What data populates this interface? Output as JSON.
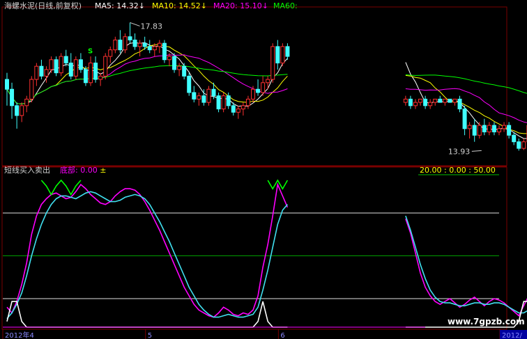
{
  "chart_data": [
    {
      "type": "candlestick",
      "title": "海螺水泥(日线,前复权)",
      "indicators": [
        {
          "name": "MA5",
          "value": "14.32",
          "arrow": "↓",
          "color": "#ffffff"
        },
        {
          "name": "MA10",
          "value": "14.52",
          "arrow": "↓",
          "color": "#ffff00"
        },
        {
          "name": "MA20",
          "value": "15.10",
          "arrow": "↓",
          "color": "#ff00ff"
        },
        {
          "name": "MA60",
          "value": "",
          "arrow": "",
          "color": "#00ff00"
        }
      ],
      "annotations": [
        {
          "text": "17.83",
          "index": 25,
          "price": 17.83,
          "side": "right"
        },
        {
          "text": "13.93",
          "index": 97,
          "price": 13.93,
          "side": "left"
        }
      ],
      "signals": [
        {
          "text": "S",
          "index": 17,
          "price": 16.6,
          "color": "#00ff00"
        }
      ],
      "ylim": [
        13.6,
        18.2
      ],
      "candles": [
        {
          "o": 16.1,
          "h": 16.3,
          "l": 15.3,
          "c": 15.8
        },
        {
          "o": 15.8,
          "h": 16.0,
          "l": 14.9,
          "c": 15.3
        },
        {
          "o": 15.3,
          "h": 15.4,
          "l": 14.6,
          "c": 15.0
        },
        {
          "o": 15.0,
          "h": 15.4,
          "l": 14.8,
          "c": 15.3
        },
        {
          "o": 15.3,
          "h": 15.6,
          "l": 15.1,
          "c": 15.5
        },
        {
          "o": 15.5,
          "h": 16.2,
          "l": 15.4,
          "c": 16.1
        },
        {
          "o": 16.1,
          "h": 16.6,
          "l": 15.9,
          "c": 16.5
        },
        {
          "o": 16.5,
          "h": 16.7,
          "l": 16.1,
          "c": 16.2
        },
        {
          "o": 16.2,
          "h": 16.5,
          "l": 16.0,
          "c": 16.4
        },
        {
          "o": 16.4,
          "h": 16.8,
          "l": 16.3,
          "c": 16.7
        },
        {
          "o": 16.7,
          "h": 16.8,
          "l": 16.2,
          "c": 16.3
        },
        {
          "o": 16.3,
          "h": 16.9,
          "l": 16.2,
          "c": 16.8
        },
        {
          "o": 16.8,
          "h": 17.0,
          "l": 16.5,
          "c": 16.6
        },
        {
          "o": 16.6,
          "h": 16.9,
          "l": 16.1,
          "c": 16.2
        },
        {
          "o": 16.2,
          "h": 16.8,
          "l": 16.1,
          "c": 16.7
        },
        {
          "o": 16.7,
          "h": 16.9,
          "l": 16.3,
          "c": 16.4
        },
        {
          "o": 16.4,
          "h": 16.5,
          "l": 15.9,
          "c": 16.0
        },
        {
          "o": 16.0,
          "h": 16.8,
          "l": 15.9,
          "c": 16.6
        },
        {
          "o": 16.6,
          "h": 16.8,
          "l": 16.0,
          "c": 16.1
        },
        {
          "o": 16.1,
          "h": 16.3,
          "l": 15.9,
          "c": 16.2
        },
        {
          "o": 16.2,
          "h": 16.9,
          "l": 16.1,
          "c": 16.8
        },
        {
          "o": 16.8,
          "h": 17.1,
          "l": 16.6,
          "c": 17.0
        },
        {
          "o": 17.0,
          "h": 17.4,
          "l": 16.9,
          "c": 17.3
        },
        {
          "o": 17.3,
          "h": 17.6,
          "l": 16.9,
          "c": 17.0
        },
        {
          "o": 17.0,
          "h": 17.5,
          "l": 16.9,
          "c": 17.4
        },
        {
          "o": 17.4,
          "h": 17.83,
          "l": 17.2,
          "c": 17.3
        },
        {
          "o": 17.3,
          "h": 17.5,
          "l": 17.0,
          "c": 17.1
        },
        {
          "o": 17.1,
          "h": 17.3,
          "l": 16.8,
          "c": 17.2
        },
        {
          "o": 17.2,
          "h": 17.4,
          "l": 17.0,
          "c": 17.1
        },
        {
          "o": 17.1,
          "h": 17.3,
          "l": 16.9,
          "c": 17.0
        },
        {
          "o": 17.0,
          "h": 17.2,
          "l": 16.8,
          "c": 17.1
        },
        {
          "o": 17.1,
          "h": 17.3,
          "l": 16.9,
          "c": 17.2
        },
        {
          "o": 17.2,
          "h": 17.3,
          "l": 16.6,
          "c": 16.7
        },
        {
          "o": 16.7,
          "h": 16.9,
          "l": 16.5,
          "c": 16.8
        },
        {
          "o": 16.8,
          "h": 16.9,
          "l": 16.3,
          "c": 16.4
        },
        {
          "o": 16.4,
          "h": 16.6,
          "l": 16.2,
          "c": 16.5
        },
        {
          "o": 16.5,
          "h": 16.6,
          "l": 16.1,
          "c": 16.2
        },
        {
          "o": 16.2,
          "h": 16.3,
          "l": 15.6,
          "c": 15.7
        },
        {
          "o": 15.7,
          "h": 15.9,
          "l": 15.4,
          "c": 15.5
        },
        {
          "o": 15.5,
          "h": 15.7,
          "l": 15.3,
          "c": 15.6
        },
        {
          "o": 15.6,
          "h": 15.8,
          "l": 15.3,
          "c": 15.4
        },
        {
          "o": 15.4,
          "h": 15.9,
          "l": 15.3,
          "c": 15.8
        },
        {
          "o": 15.8,
          "h": 16.0,
          "l": 15.5,
          "c": 15.6
        },
        {
          "o": 15.6,
          "h": 15.7,
          "l": 15.1,
          "c": 15.2
        },
        {
          "o": 15.2,
          "h": 15.7,
          "l": 15.1,
          "c": 15.6
        },
        {
          "o": 15.6,
          "h": 15.7,
          "l": 15.2,
          "c": 15.3
        },
        {
          "o": 15.3,
          "h": 15.4,
          "l": 15.0,
          "c": 15.1
        },
        {
          "o": 15.1,
          "h": 15.3,
          "l": 14.9,
          "c": 15.2
        },
        {
          "o": 15.2,
          "h": 15.4,
          "l": 15.0,
          "c": 15.3
        },
        {
          "o": 15.3,
          "h": 15.6,
          "l": 15.2,
          "c": 15.5
        },
        {
          "o": 15.5,
          "h": 15.9,
          "l": 15.4,
          "c": 15.8
        },
        {
          "o": 15.8,
          "h": 16.1,
          "l": 15.6,
          "c": 15.7
        },
        {
          "o": 15.7,
          "h": 16.2,
          "l": 15.6,
          "c": 16.0
        },
        {
          "o": 16.0,
          "h": 16.2,
          "l": 15.8,
          "c": 16.1
        },
        {
          "o": 16.1,
          "h": 17.2,
          "l": 16.0,
          "c": 17.1
        },
        {
          "o": 17.1,
          "h": 17.3,
          "l": 16.4,
          "c": 16.6
        },
        {
          "o": 16.6,
          "h": 17.2,
          "l": 16.5,
          "c": 17.1
        },
        {
          "o": 17.1,
          "h": 17.2,
          "l": 16.7,
          "c": 16.8
        },
        null,
        null,
        null,
        null,
        null,
        null,
        null,
        null,
        null,
        null,
        null,
        null,
        null,
        null,
        null,
        null,
        null,
        null,
        null,
        null,
        null,
        null,
        null,
        {
          "o": 15.4,
          "h": 15.6,
          "l": 15.3,
          "c": 15.5
        },
        {
          "o": 15.5,
          "h": 15.6,
          "l": 15.2,
          "c": 15.3
        },
        {
          "o": 15.3,
          "h": 15.5,
          "l": 15.2,
          "c": 15.4
        },
        {
          "o": 15.4,
          "h": 15.5,
          "l": 15.3,
          "c": 15.5
        },
        {
          "o": 15.5,
          "h": 15.6,
          "l": 15.2,
          "c": 15.3
        },
        {
          "o": 15.3,
          "h": 15.5,
          "l": 15.2,
          "c": 15.4
        },
        {
          "o": 15.4,
          "h": 15.5,
          "l": 15.3,
          "c": 15.5
        },
        {
          "o": 15.5,
          "h": 15.6,
          "l": 15.4,
          "c": 15.4
        },
        {
          "o": 15.4,
          "h": 15.5,
          "l": 15.3,
          "c": 15.5
        },
        {
          "o": 15.5,
          "h": 15.5,
          "l": 15.4,
          "c": 15.4
        },
        {
          "o": 15.4,
          "h": 15.5,
          "l": 15.3,
          "c": 15.5
        },
        {
          "o": 15.5,
          "h": 15.6,
          "l": 15.1,
          "c": 15.2
        },
        {
          "o": 15.2,
          "h": 15.3,
          "l": 14.4,
          "c": 14.6
        },
        {
          "o": 14.6,
          "h": 14.8,
          "l": 14.3,
          "c": 14.7
        },
        {
          "o": 14.7,
          "h": 14.9,
          "l": 14.2,
          "c": 14.4
        },
        {
          "o": 14.4,
          "h": 14.8,
          "l": 14.3,
          "c": 14.7
        },
        {
          "o": 14.7,
          "h": 14.9,
          "l": 14.4,
          "c": 14.5
        },
        {
          "o": 14.5,
          "h": 14.8,
          "l": 14.4,
          "c": 14.7
        },
        {
          "o": 14.7,
          "h": 14.8,
          "l": 14.4,
          "c": 14.5
        },
        {
          "o": 14.5,
          "h": 14.7,
          "l": 14.4,
          "c": 14.6
        },
        {
          "o": 14.6,
          "h": 14.8,
          "l": 14.5,
          "c": 14.7
        },
        {
          "o": 14.7,
          "h": 14.8,
          "l": 14.3,
          "c": 14.4
        },
        {
          "o": 14.4,
          "h": 14.5,
          "l": 14.1,
          "c": 14.2
        },
        {
          "o": 14.2,
          "h": 14.3,
          "l": 13.93,
          "c": 14.0
        },
        {
          "o": 14.0,
          "h": 14.3,
          "l": 13.95,
          "c": 14.2
        },
        {
          "o": 14.2,
          "h": 14.8,
          "l": 14.1,
          "c": 14.7
        }
      ]
    },
    {
      "type": "line",
      "title": "短线买入卖出",
      "indicators": [
        {
          "name": "底部",
          "value": "0.00",
          "suffix": "±",
          "color": "#ff00ff"
        }
      ],
      "right_readout": {
        "a": "20.00",
        "b": "0.00",
        "c": "50.00"
      },
      "ylim": [
        0,
        100
      ],
      "ref_lines": [
        {
          "value": 80,
          "color": "#e0e0e0"
        },
        {
          "value": 50,
          "color": "#00a000"
        },
        {
          "value": 20,
          "color": "#e0e0e0"
        }
      ],
      "series": [
        {
          "color": "#ff00ff",
          "values": [
            14,
            10,
            18,
            30,
            45,
            65,
            78,
            86,
            90,
            93,
            94,
            92,
            90,
            91,
            95,
            100,
            97,
            93,
            90,
            87,
            86,
            88,
            92,
            95,
            97,
            97,
            96,
            93,
            88,
            82,
            75,
            68,
            60,
            52,
            44,
            36,
            28,
            22,
            16,
            12,
            10,
            8,
            7,
            10,
            14,
            12,
            9,
            8,
            10,
            9,
            12,
            22,
            42,
            58,
            78,
            100,
            92,
            84,
            null,
            null,
            null,
            null,
            null,
            null,
            null,
            null,
            null,
            null,
            null,
            null,
            null,
            null,
            null,
            null,
            null,
            null,
            null,
            null,
            null,
            null,
            null,
            76,
            66,
            52,
            38,
            28,
            22,
            18,
            16,
            18,
            20,
            17,
            14,
            16,
            19,
            21,
            18,
            15,
            18,
            20,
            19,
            17,
            14,
            11,
            8,
            15,
            22,
            28,
            26,
            22,
            20,
            18,
            24,
            30
          ]
        },
        {
          "color": "#40e0f0",
          "values": [
            6,
            10,
            16,
            24,
            36,
            50,
            62,
            72,
            80,
            86,
            90,
            92,
            92,
            91,
            90,
            92,
            94,
            95,
            94,
            92,
            90,
            88,
            88,
            89,
            91,
            92,
            93,
            92,
            90,
            86,
            80,
            74,
            67,
            60,
            52,
            44,
            36,
            28,
            22,
            16,
            12,
            9,
            7,
            7,
            8,
            9,
            8,
            7,
            7,
            8,
            9,
            14,
            26,
            40,
            56,
            72,
            82,
            86,
            null,
            null,
            null,
            null,
            null,
            null,
            null,
            null,
            null,
            null,
            null,
            null,
            null,
            null,
            null,
            null,
            null,
            null,
            null,
            null,
            null,
            null,
            null,
            78,
            68,
            56,
            44,
            34,
            26,
            21,
            18,
            17,
            17,
            16,
            15,
            15,
            16,
            17,
            17,
            16,
            16,
            17,
            17,
            16,
            14,
            12,
            10,
            10,
            12,
            15,
            18,
            20,
            19,
            18,
            19,
            21
          ]
        },
        {
          "color": "#ffffff",
          "values": [
            4,
            18,
            18,
            4,
            0,
            0,
            0,
            0,
            0,
            0,
            0,
            0,
            0,
            0,
            0,
            0,
            0,
            0,
            0,
            0,
            0,
            0,
            0,
            0,
            0,
            0,
            0,
            0,
            0,
            0,
            0,
            0,
            0,
            0,
            0,
            0,
            0,
            0,
            0,
            0,
            0,
            0,
            0,
            0,
            0,
            0,
            0,
            0,
            0,
            0,
            0,
            4,
            18,
            4,
            0,
            0,
            0,
            0,
            null,
            null,
            null,
            null,
            null,
            null,
            null,
            null,
            null,
            null,
            null,
            null,
            null,
            null,
            null,
            null,
            null,
            null,
            null,
            null,
            null,
            null,
            null,
            0,
            0,
            0,
            0,
            0,
            0,
            0,
            0,
            0,
            0,
            0,
            0,
            0,
            0,
            0,
            0,
            0,
            0,
            0,
            0,
            0,
            0,
            0,
            4,
            18,
            18,
            4,
            0,
            18,
            18,
            4,
            0,
            18
          ]
        }
      ],
      "peak_marks": [
        {
          "color": "#00ff00",
          "start": 7,
          "values": [
            100,
            96,
            90,
            96,
            100,
            96,
            90,
            96,
            100
          ]
        },
        {
          "color": "#00ff00",
          "start": 53,
          "values": [
            100,
            94,
            100,
            94,
            100
          ]
        }
      ]
    }
  ],
  "x_axis": {
    "labels": [
      {
        "text": "2012年4",
        "index": 0,
        "highlight": false
      },
      {
        "text": "5",
        "index": 29,
        "highlight": false
      },
      {
        "text": "6",
        "index": 56,
        "highlight": false
      },
      {
        "text": "2012/",
        "index": 101,
        "highlight": true
      }
    ]
  },
  "watermark": "www.7gpzb.com"
}
